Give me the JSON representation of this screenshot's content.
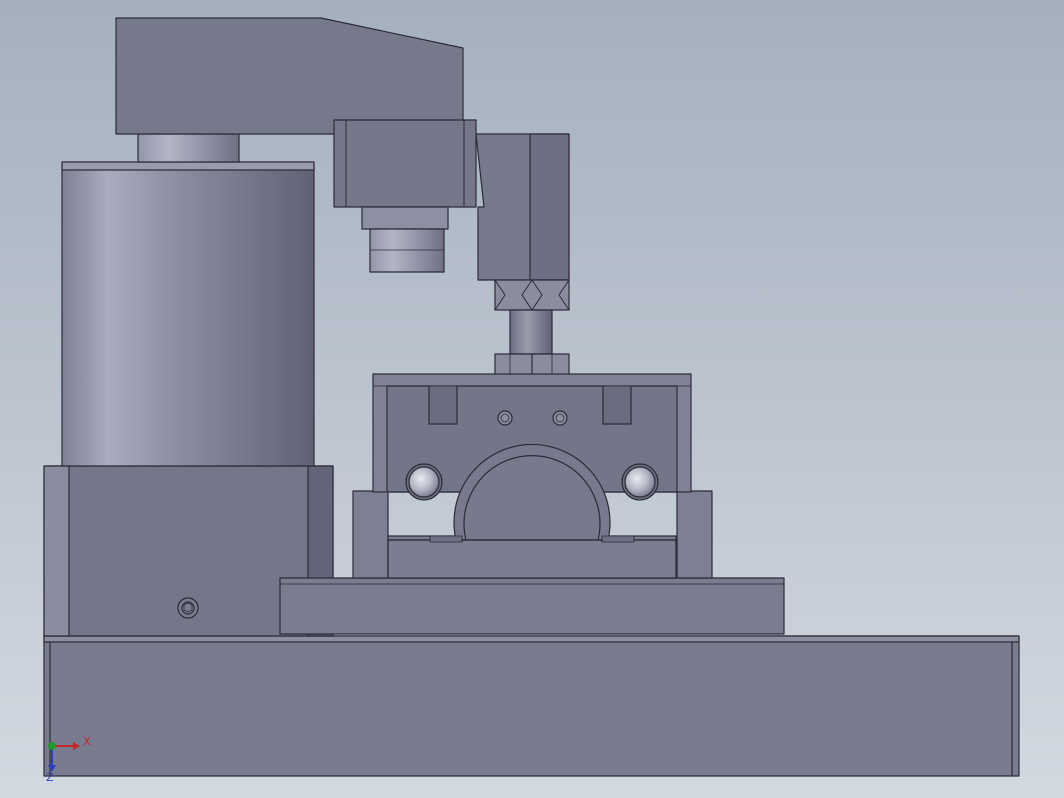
{
  "viewport": {
    "background_top": "#a5b0bf",
    "background_bottom": "#d3d9e1"
  },
  "model": {
    "view": "front",
    "body_color": "#7c7e90",
    "outline_color": "#2c2c38"
  },
  "triad": {
    "x_label": "X",
    "z_label": "Z",
    "x_color": "#c0282a",
    "y_color": "#1f9b2e",
    "z_color": "#2a3fbf"
  }
}
